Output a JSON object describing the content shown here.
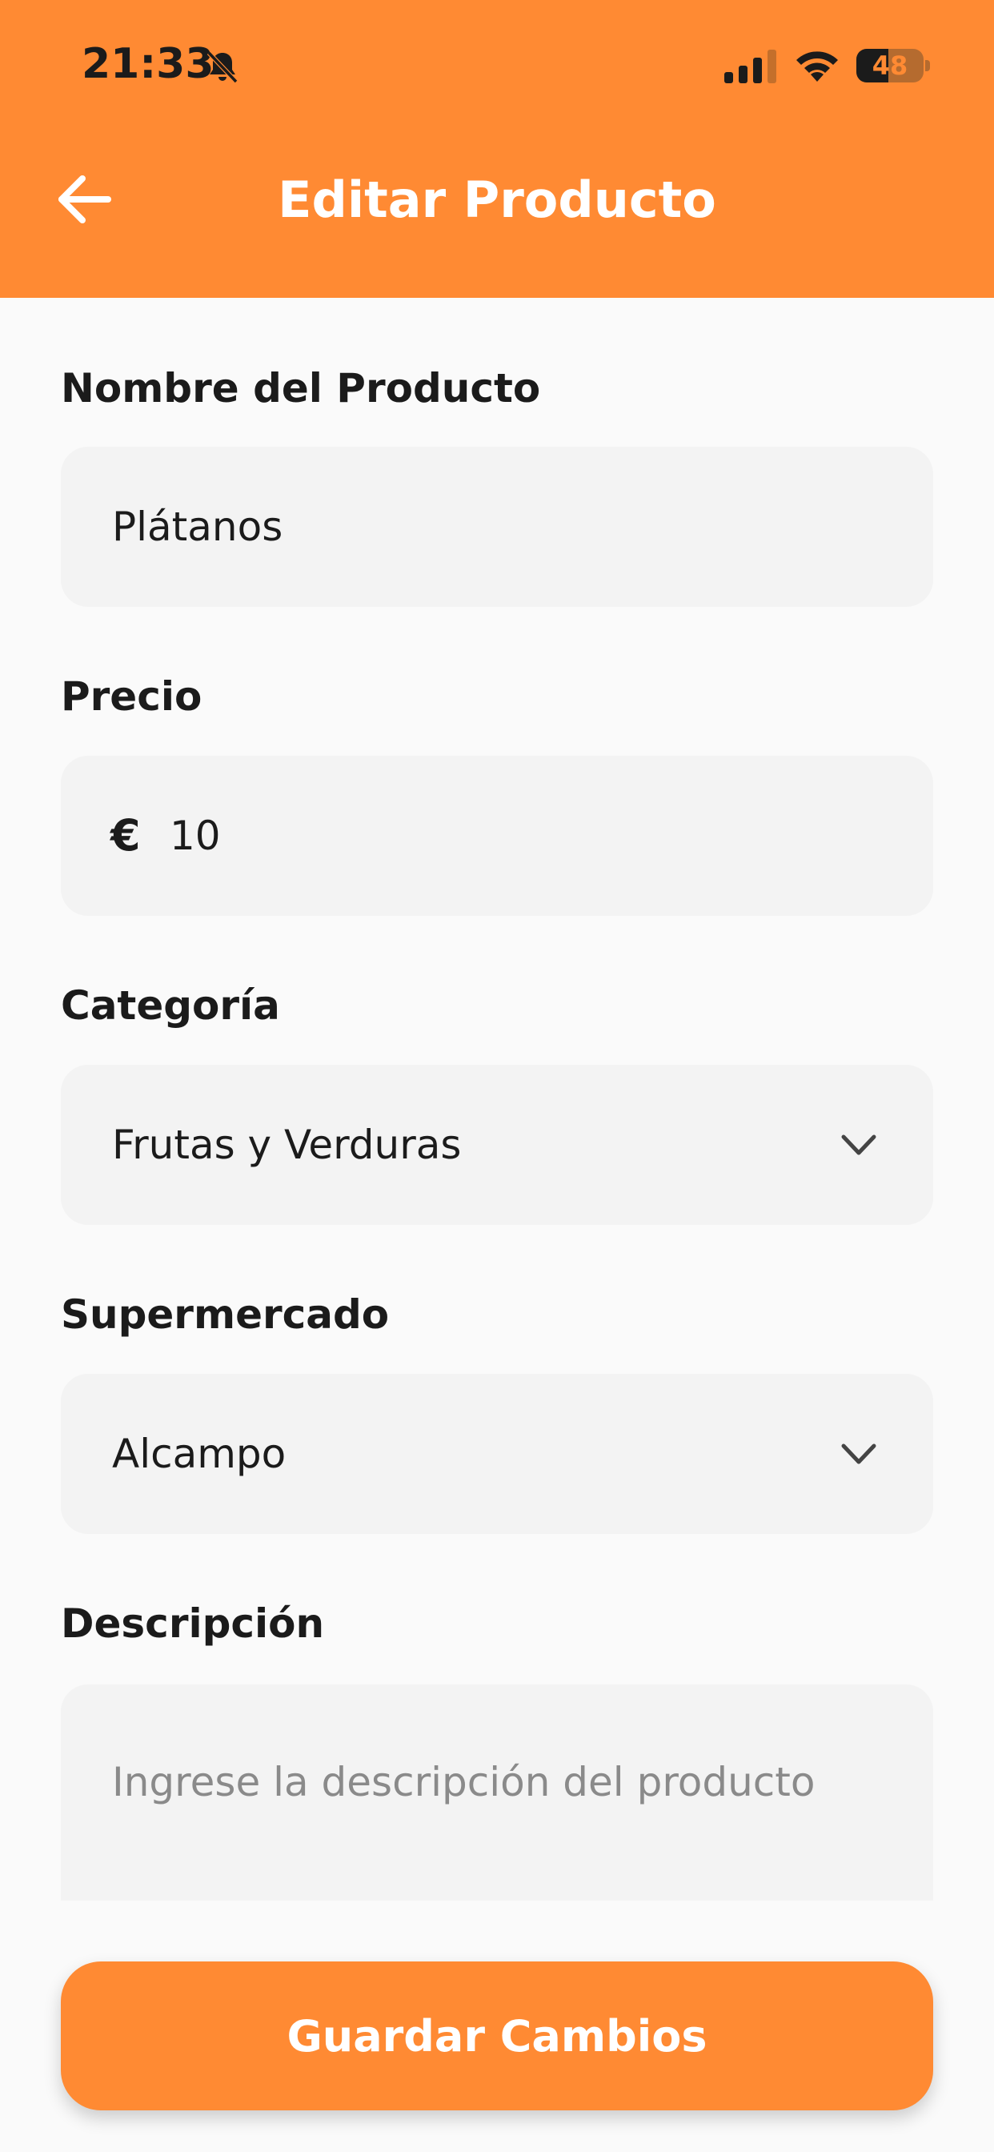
{
  "status_bar": {
    "time": "21:33",
    "battery": "48",
    "battery_level": 0.48,
    "icons": [
      "bell-slash-icon",
      "signal-icon",
      "wifi-icon",
      "battery-icon"
    ]
  },
  "header": {
    "title": "Editar Producto",
    "back_icon": "arrow-left-icon",
    "background_color": "#ff8a33"
  },
  "form": {
    "name": {
      "label": "Nombre del Producto",
      "value": "Plátanos"
    },
    "price": {
      "label": "Precio",
      "currency_symbol": "€",
      "value": "10"
    },
    "category": {
      "label": "Categoría",
      "selected": "Frutas y Verduras",
      "icon": "chevron-down-icon"
    },
    "supermarket": {
      "label": "Supermercado",
      "selected": "Alcampo",
      "icon": "chevron-down-icon"
    },
    "description": {
      "label": "Descripción",
      "placeholder": "Ingrese la descripción del producto"
    }
  },
  "actions": {
    "save_label": "Guardar Cambios",
    "accent_color": "#ff8a33"
  }
}
